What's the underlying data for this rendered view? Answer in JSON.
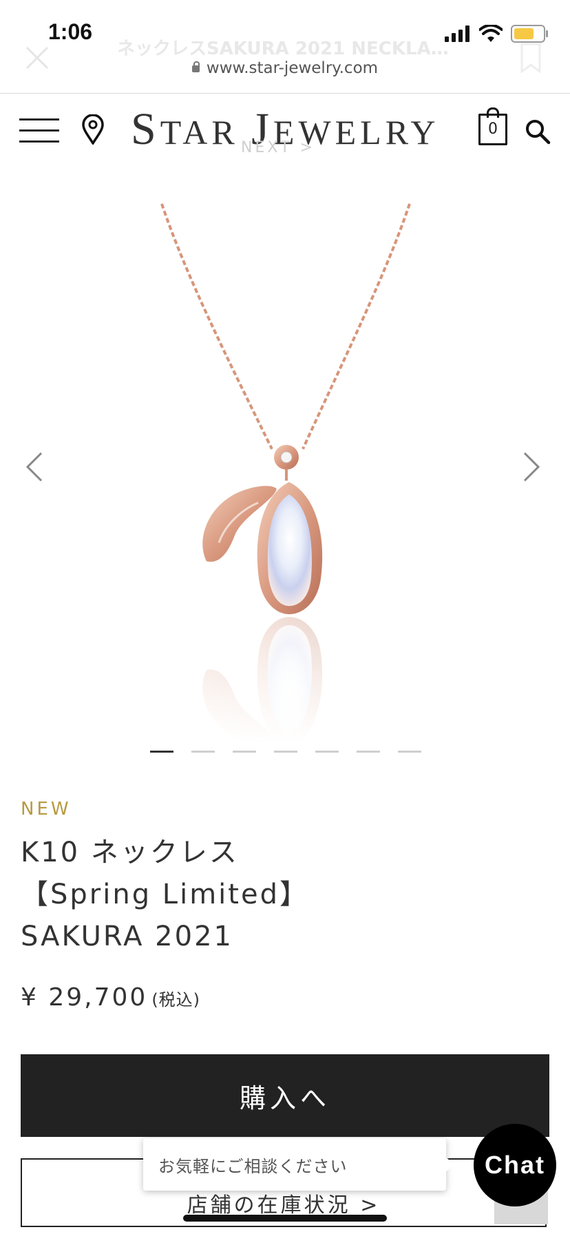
{
  "status_bar": {
    "time": "1:06"
  },
  "browser": {
    "page_title": "ネックレスSAKURA 2021 NECKLACE...",
    "url": "www.star-jewelry.com"
  },
  "header": {
    "logo_parts": [
      "S",
      "TAR ",
      "J",
      "EWELRY"
    ],
    "next_label": "NEXT >",
    "cart_count": "0"
  },
  "carousel": {
    "slide_count": 7,
    "active_index": 0
  },
  "product": {
    "badge": "NEW",
    "name_lines": [
      "K10 ネックレス",
      "【Spring Limited】",
      "SAKURA 2021"
    ],
    "price": "¥ 29,700",
    "tax_note": "(税込)"
  },
  "actions": {
    "buy_label": "購入へ",
    "stock_label": "店舗の在庫状況 >"
  },
  "chat": {
    "tooltip": "お気軽にご相談ください",
    "button": "Chat"
  },
  "colors": {
    "accent_gold": "#b89a42",
    "primary_dark": "#222222",
    "chain_rose_gold": "#d7957a",
    "battery": "#f6c844"
  }
}
